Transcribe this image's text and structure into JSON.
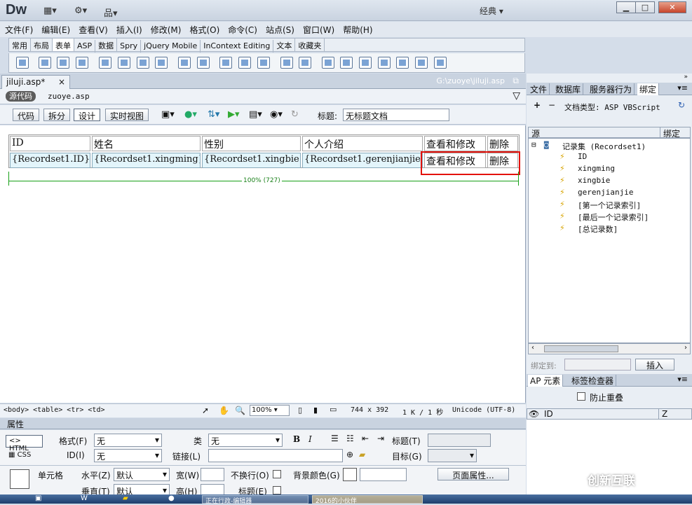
{
  "app": {
    "logo": "Dw",
    "workspace": "经典",
    "win_min": "▁",
    "win_max": "□",
    "win_close": "✕"
  },
  "menu": [
    "文件(F)",
    "编辑(E)",
    "查看(V)",
    "插入(I)",
    "修改(M)",
    "格式(O)",
    "命令(C)",
    "站点(S)",
    "窗口(W)",
    "帮助(H)"
  ],
  "insert_tabs": [
    {
      "label": "常用"
    },
    {
      "label": "布局"
    },
    {
      "label": "表单",
      "active": true
    },
    {
      "label": "ASP"
    },
    {
      "label": "数据"
    },
    {
      "label": "Spry"
    },
    {
      "label": "jQuery Mobile"
    },
    {
      "label": "InContext Editing"
    },
    {
      "label": "文本"
    },
    {
      "label": "收藏夹"
    }
  ],
  "doc": {
    "tab": "jiluji.asp*",
    "close": "×",
    "path": "G:\\zuoye\\jiluji.asp",
    "source_label": "源代码",
    "related_file": "zuoye.asp"
  },
  "views": {
    "code": "代码",
    "split": "拆分",
    "design": "设计",
    "live": "实时视图",
    "title_label": "标题:",
    "title_value": "无标题文档"
  },
  "table": {
    "headers": [
      "ID",
      "姓名",
      "性别",
      "个人介绍",
      "查看和修改",
      "删除"
    ],
    "row": [
      "{Recordset1.ID}",
      "{Recordset1.xingming}",
      "{Recordset1.xingbie}",
      "{Recordset1.gerenjianjie}",
      "查看和修改",
      "删除"
    ],
    "width_label": "100% (727)"
  },
  "status": {
    "tags": "<body> <table> <tr> <td>",
    "zoom": "100%",
    "size": "744 x 392",
    "download": "1 K / 1 秒",
    "encoding": "Unicode (UTF-8)"
  },
  "properties": {
    "panel_title": "属性",
    "html_btn": "HTML",
    "css_btn": "CSS",
    "format_label": "格式(F)",
    "format_value": "无",
    "class_label": "类",
    "class_value": "无",
    "id_label": "ID(I)",
    "id_value": "无",
    "link_label": "链接(L)",
    "title_label": "标题(T)",
    "target_label": "目标(G)",
    "cell_label": "单元格",
    "halign_label": "水平(Z)",
    "halign_value": "默认",
    "valign_label": "垂直(T)",
    "valign_value": "默认",
    "width_label": "宽(W)",
    "height_label": "高(H)",
    "nowrap_label": "不换行(O)",
    "header_label": "标题(E)",
    "bg_label": "背景颜色(G)",
    "page_props": "页面属性..."
  },
  "right_panel": {
    "tabs": [
      "文件",
      "数据库",
      "服务器行为",
      "绑定"
    ],
    "doctype_label": "文档类型: ASP VBScript",
    "col_source": "源",
    "col_binding": "绑定",
    "recordset": "记录集 (Recordset1)",
    "fields": [
      "ID",
      "xingming",
      "xingbie",
      "gerenjianjie",
      "[第一个记录索引]",
      "[最后一个记录索引]",
      "[总记录数]"
    ],
    "bind_to": "绑定到:",
    "insert_btn": "插入",
    "ap_tabs": [
      "AP 元素",
      "标签检查器"
    ],
    "prevent_overlap": "防止重叠",
    "ap_col_id": "ID",
    "ap_col_z": "Z"
  },
  "taskbar": [
    "正在行政-编辑器",
    "2016的小伙伴"
  ],
  "watermark": "创新互联"
}
